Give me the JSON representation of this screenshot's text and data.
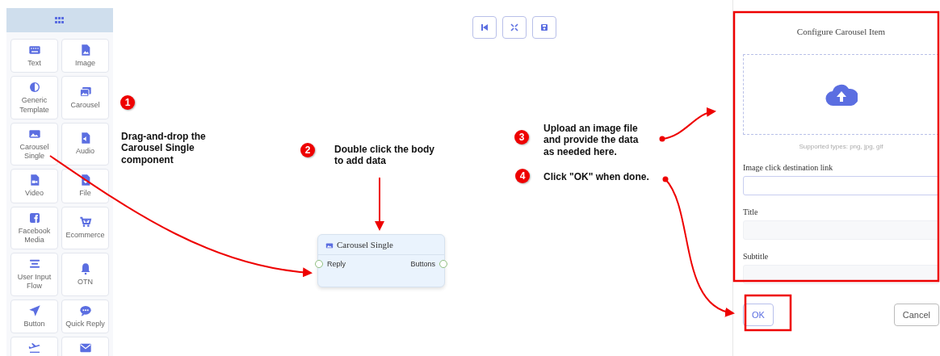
{
  "palette": {
    "items": [
      {
        "label": "Text"
      },
      {
        "label": "Image"
      },
      {
        "label": "Generic Template"
      },
      {
        "label": "Carousel"
      },
      {
        "label": "Carousel Single"
      },
      {
        "label": "Audio"
      },
      {
        "label": "Video"
      },
      {
        "label": "File"
      },
      {
        "label": "Facebook Media"
      },
      {
        "label": "Ecommerce"
      },
      {
        "label": "User Input Flow"
      },
      {
        "label": "OTN"
      },
      {
        "label": "Button"
      },
      {
        "label": "Quick Reply"
      }
    ]
  },
  "node": {
    "title": "Carousel Single",
    "input": "Reply",
    "output": "Buttons"
  },
  "annotations": [
    {
      "number": "1",
      "text": "Drag-and-drop the\nCarousel Single\ncomponent"
    },
    {
      "number": "2",
      "text": "Double click the body\nto add data"
    },
    {
      "number": "3",
      "text": "Upload an image file\nand provide the data\nas needed here."
    },
    {
      "number": "4",
      "text": "Click \"OK\" when done."
    }
  ],
  "dialog": {
    "title": "Configure Carousel Item",
    "upload_hint": "Supported types: png, jpg, gif",
    "fields": [
      {
        "label": "Image click destination link",
        "focused": true
      },
      {
        "label": "Title",
        "focused": false
      },
      {
        "label": "Subtitle",
        "focused": false
      }
    ],
    "buttons": [
      {
        "label": "OK",
        "kind": "primary"
      },
      {
        "label": "Cancel",
        "kind": "secondary"
      }
    ]
  }
}
